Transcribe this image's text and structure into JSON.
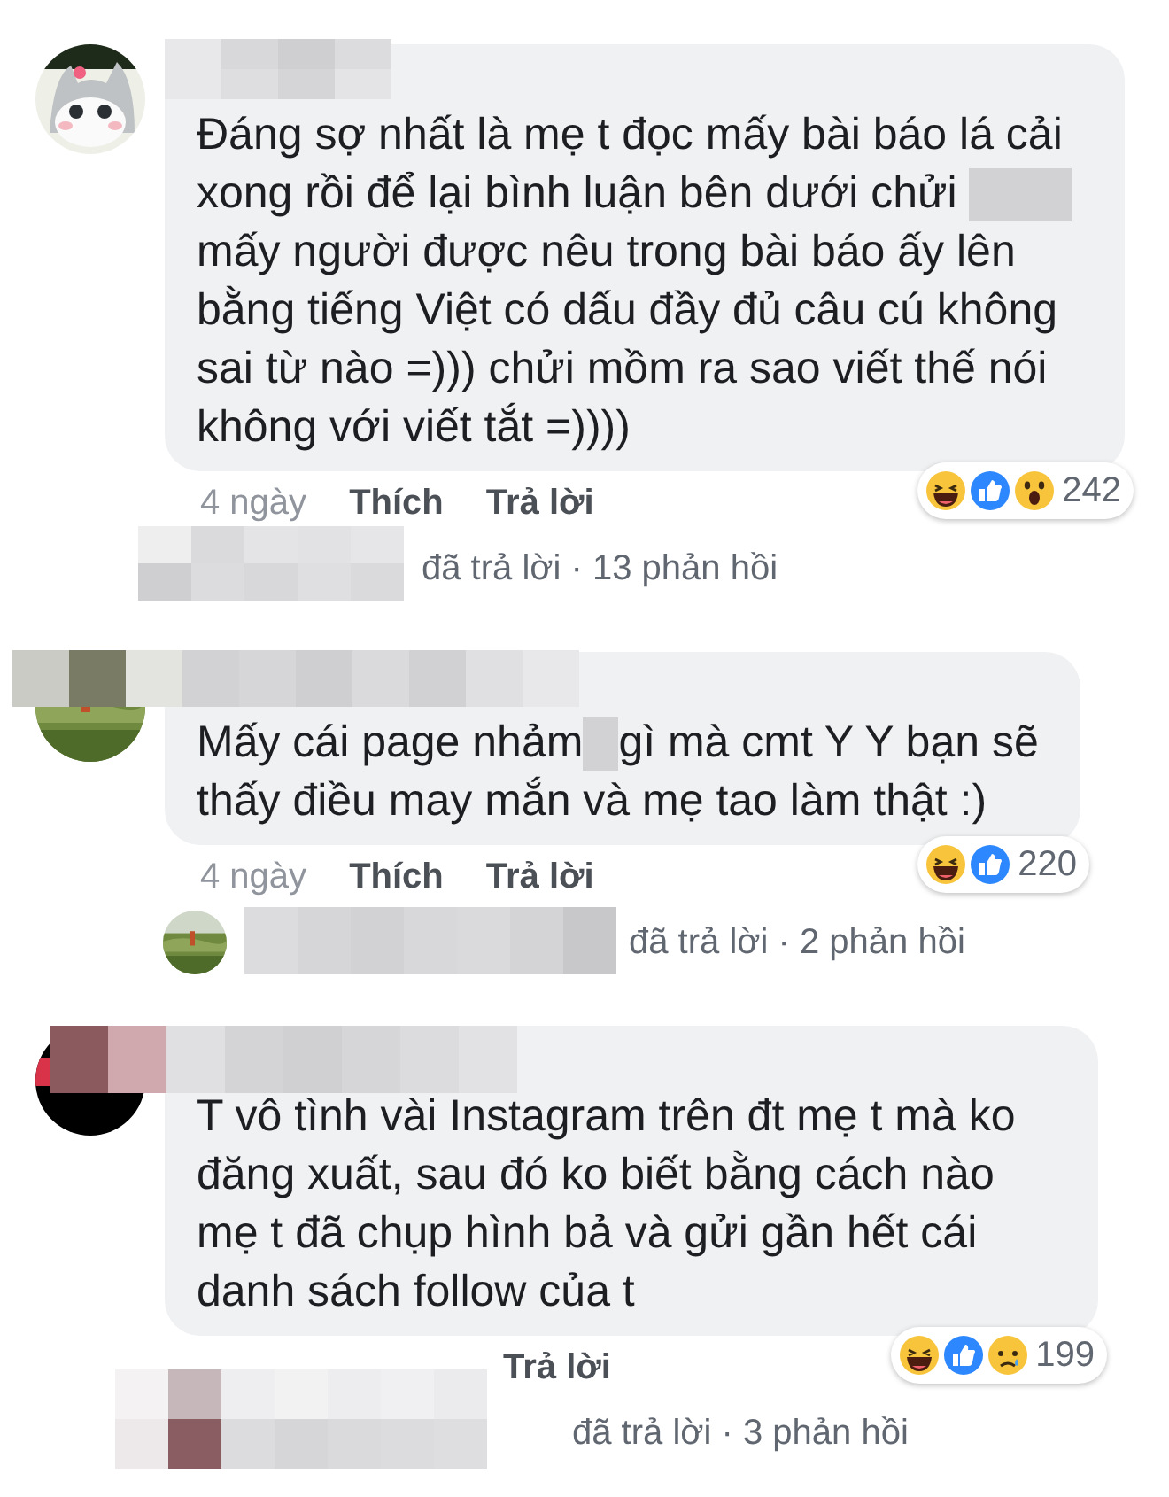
{
  "comments": [
    {
      "avatar": {
        "kind": "cat"
      },
      "body": [
        {
          "kind": "text",
          "text": "Đáng sợ nhất là mẹ t đọc mấy bài báo lá cải xong rồi để lại bình luận bên dưới chửi "
        },
        {
          "kind": "censor"
        },
        {
          "kind": "text",
          "text": " mấy người được nêu trong bài báo ấy lên bằng tiếng Việt có dấu đầy đủ câu cú không sai từ nào =))) chửi mồm ra sao viết thế nói không với viết tắt =))))"
        }
      ],
      "time": "4 ngày",
      "like": "Thích",
      "reply": "Trả lời",
      "reactions": [
        {
          "kind": "haha"
        },
        {
          "kind": "like"
        },
        {
          "kind": "wow"
        }
      ],
      "reaction_count": "242",
      "replies": {
        "avatar": {
          "kind": "hidden"
        },
        "text": "đã trả lời · 13 phản hồi"
      }
    },
    {
      "avatar": {
        "kind": "field"
      },
      "body": [
        {
          "kind": "text",
          "text": "Mấy cái page nhảm"
        },
        {
          "kind": "censor"
        },
        {
          "kind": "text",
          "text": "gì mà cmt Y Y bạn sẽ thấy điều may mắn và mẹ tao làm thật :)"
        }
      ],
      "time": "4 ngày",
      "like": "Thích",
      "reply": "Trả lời",
      "reactions": [
        {
          "kind": "haha"
        },
        {
          "kind": "like"
        }
      ],
      "reaction_count": "220",
      "replies": {
        "avatar": {
          "kind": "field"
        },
        "text": "đã trả lời · 2 phản hồi"
      }
    },
    {
      "avatar": {
        "kind": "dark"
      },
      "body": [
        {
          "kind": "text",
          "text": "T vô tình vài Instagram trên đt mẹ t mà ko đăng xuất, sau đó ko biết bằng cách nào mẹ t đã chụp hình bả và gửi gần hết cái danh sách follow của t"
        }
      ],
      "reply": "Trả lời",
      "reactions": [
        {
          "kind": "haha"
        },
        {
          "kind": "like"
        },
        {
          "kind": "sad"
        }
      ],
      "reaction_count": "199",
      "replies": {
        "avatar": {
          "kind": "hidden"
        },
        "text": "đã trả lời · 3 phản hồi"
      }
    }
  ]
}
